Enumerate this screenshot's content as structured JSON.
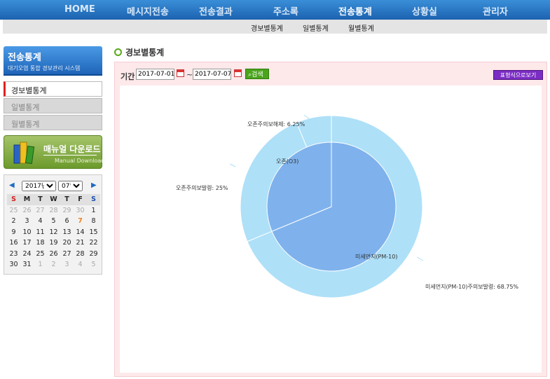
{
  "topnav": {
    "items": [
      {
        "label": "HOME",
        "active": false
      },
      {
        "label": "메시지전송",
        "active": false
      },
      {
        "label": "전송결과",
        "active": false
      },
      {
        "label": "주소록",
        "active": false
      },
      {
        "label": "전송통계",
        "active": true
      },
      {
        "label": "상황실",
        "active": false
      },
      {
        "label": "관리자",
        "active": false
      }
    ]
  },
  "subnav": {
    "items": [
      "경보별통계",
      "일별통계",
      "월별통계"
    ]
  },
  "sidebar": {
    "title": "전송통계",
    "subtitle": "대기오염 통합 경보관리 시스템",
    "items": [
      {
        "label": "경보별통계",
        "active": true
      },
      {
        "label": "일별통계",
        "active": false
      },
      {
        "label": "월별통계",
        "active": false
      }
    ],
    "manual": {
      "label": "매뉴얼 다운로드",
      "sublabel": "Manual Download"
    }
  },
  "calendar": {
    "year": "2017년",
    "month": "07월",
    "weekdays": [
      "S",
      "M",
      "T",
      "W",
      "T",
      "F",
      "S"
    ],
    "weeks": [
      [
        "25",
        "26",
        "27",
        "28",
        "29",
        "30",
        "1"
      ],
      [
        "2",
        "3",
        "4",
        "5",
        "6",
        "7",
        "8"
      ],
      [
        "9",
        "10",
        "11",
        "12",
        "13",
        "14",
        "15"
      ],
      [
        "16",
        "17",
        "18",
        "19",
        "20",
        "21",
        "22"
      ],
      [
        "23",
        "24",
        "25",
        "26",
        "27",
        "28",
        "29"
      ],
      [
        "30",
        "31",
        "1",
        "2",
        "3",
        "4",
        "5"
      ]
    ],
    "today": "7"
  },
  "main": {
    "title": "경보별통계",
    "period_label": "기간",
    "start_date": "2017-07-01",
    "tilde": "~",
    "end_date": "2017-07-07",
    "search_label": "검색",
    "table_view_label": "표형식으로보기"
  },
  "colors": {
    "inner": "#7fb2ec",
    "outer": "#aee0f8",
    "nav": "#1c62b0"
  },
  "chart_data": {
    "type": "pie",
    "inner": [
      {
        "label": "미세먼지(PM-10)",
        "value": 68.75
      },
      {
        "label": "오존(O3)",
        "value": 31.25
      }
    ],
    "outer": [
      {
        "label": "미세먼지(PM-10)주의보발령: 68.75%",
        "value": 68.75
      },
      {
        "label": "오존주의보발령: 25%",
        "value": 25
      },
      {
        "label": "오존주의보해제: 6.25%",
        "value": 6.25
      }
    ]
  }
}
